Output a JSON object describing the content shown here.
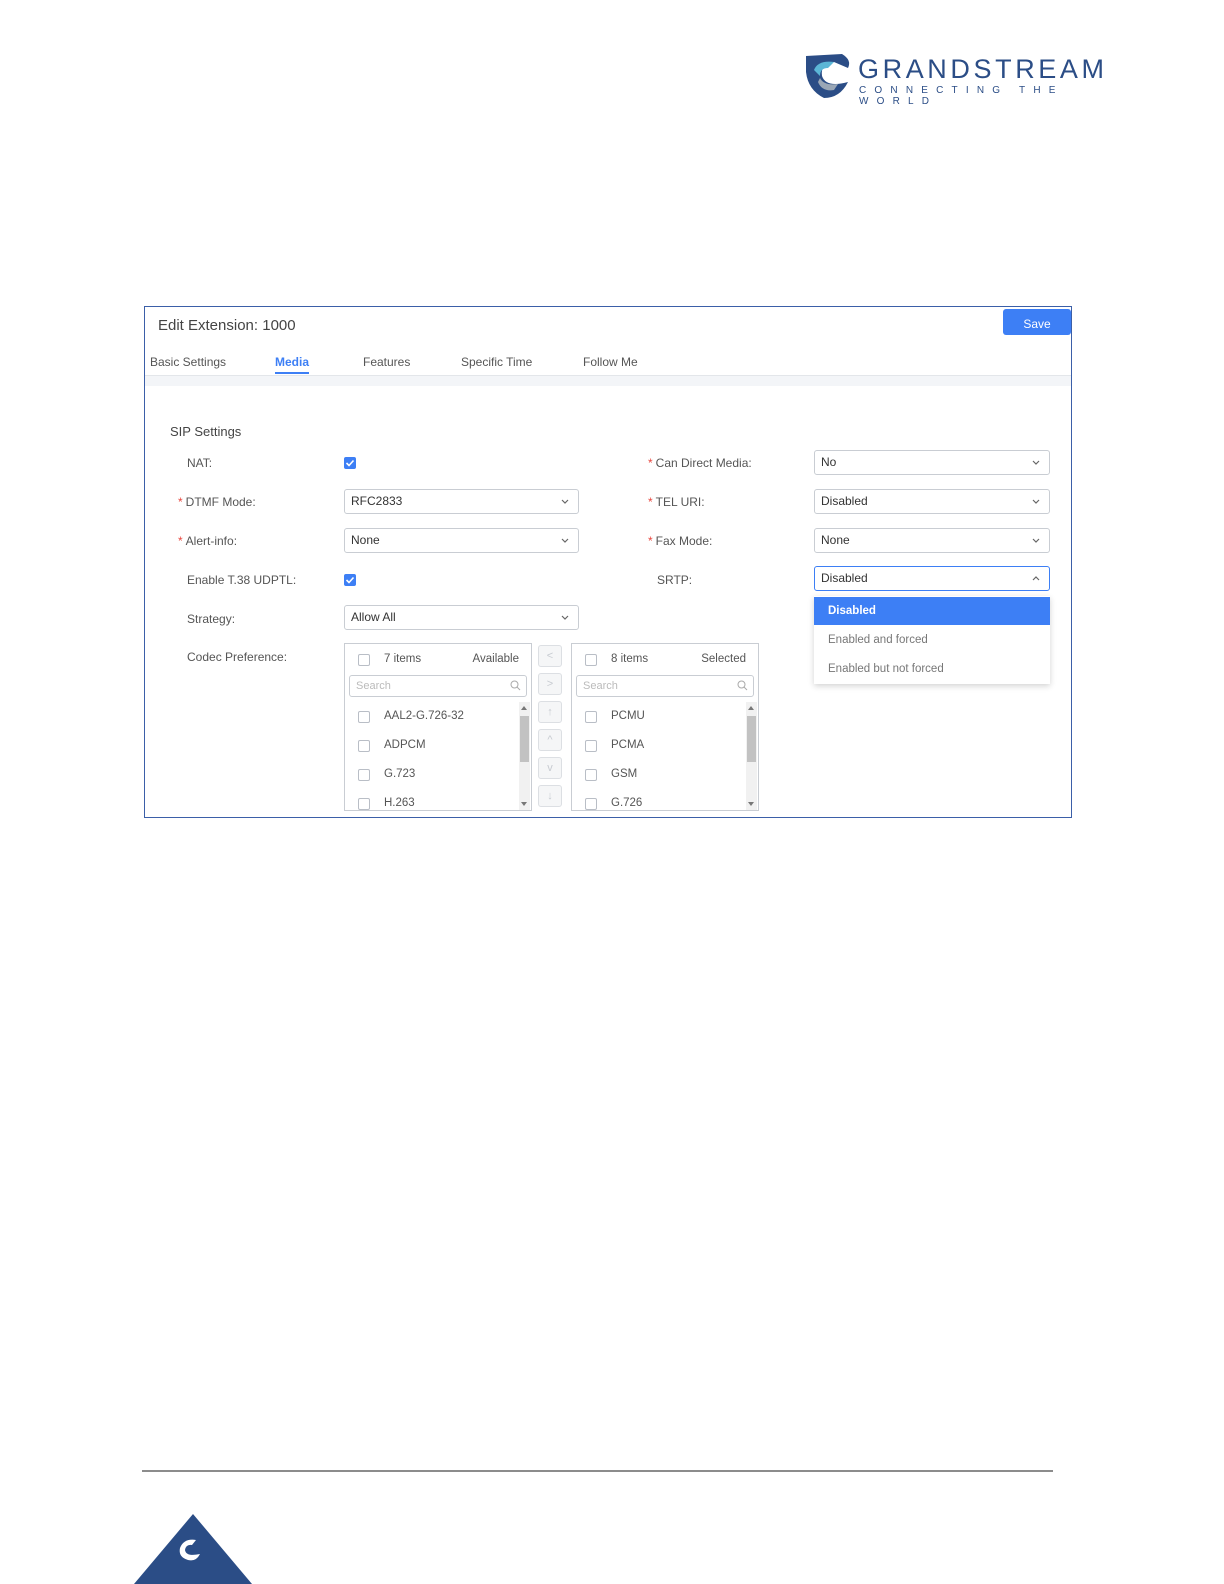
{
  "brand": {
    "name": "GRANDSTREAM",
    "tagline": "CONNECTING THE WORLD",
    "color": "#2b4d86"
  },
  "header": {
    "title": "Edit Extension: 1000",
    "save_label": "Save"
  },
  "tabs": [
    {
      "label": "Basic Settings",
      "active": false
    },
    {
      "label": "Media",
      "active": true
    },
    {
      "label": "Features",
      "active": false
    },
    {
      "label": "Specific Time",
      "active": false
    },
    {
      "label": "Follow Me",
      "active": false
    }
  ],
  "sip": {
    "section_title": "SIP Settings",
    "nat_label": "NAT:",
    "nat_checked": true,
    "dtmf_label": "DTMF Mode:",
    "dtmf_value": "RFC2833",
    "alert_label": "Alert-info:",
    "alert_value": "None",
    "t38_label": "Enable T.38 UDPTL:",
    "t38_checked": true,
    "strategy_label": "Strategy:",
    "strategy_value": "Allow All",
    "codec_label": "Codec Preference:",
    "direct_media_label": "Can Direct Media:",
    "direct_media_value": "No",
    "tel_uri_label": "TEL URI:",
    "tel_uri_value": "Disabled",
    "fax_label": "Fax Mode:",
    "fax_value": "None",
    "srtp_label": "SRTP:",
    "srtp_value": "Disabled",
    "required_mark": "*"
  },
  "srtp_options": [
    "Disabled",
    "Enabled and forced",
    "Enabled but not forced"
  ],
  "available": {
    "count": "7 items",
    "title": "Available",
    "search_placeholder": "Search",
    "items": [
      "AAL2-G.726-32",
      "ADPCM",
      "G.723",
      "H.263"
    ]
  },
  "selected": {
    "count": "8 items",
    "title": "Selected",
    "search_placeholder": "Search",
    "items": [
      "PCMU",
      "PCMA",
      "GSM",
      "G.726"
    ]
  },
  "move_buttons": [
    "<",
    ">",
    "↑",
    "^",
    "v",
    "↓"
  ],
  "accent": "#3d7ff5"
}
